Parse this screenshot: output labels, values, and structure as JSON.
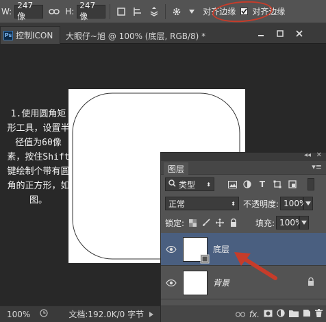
{
  "options_bar": {
    "w_label": "W:",
    "w_value": "247 像",
    "h_label": "H:",
    "h_value": "247 像",
    "align_edges": "对齐边缘",
    "align_overlay": "对齐边缘"
  },
  "document": {
    "tab_title": "控制ICON",
    "window_title": "大眼仔~旭 @ 100% (底层, RGB/8) *"
  },
  "note": {
    "text": "1.使用圆角矩形工具，设置半径值为60像素，按住Shift键绘制个带有圆角的正方形，如图。"
  },
  "layers_panel": {
    "tab_label": "图层",
    "filter_type": "类型",
    "blend_mode": "正常",
    "opacity_label": "不透明度:",
    "opacity_value": "100%",
    "lock_label": "锁定:",
    "fill_label": "填充:",
    "fill_value": "100%",
    "layers": [
      {
        "name": "底层",
        "selected": true
      },
      {
        "name": "背景",
        "selected": false
      }
    ]
  },
  "status": {
    "zoom": "100%",
    "doc_info": "文档:192.0K/0 字节"
  },
  "colors": {
    "accent_red": "#c63c2a",
    "selected_layer": "#4a5f80"
  }
}
